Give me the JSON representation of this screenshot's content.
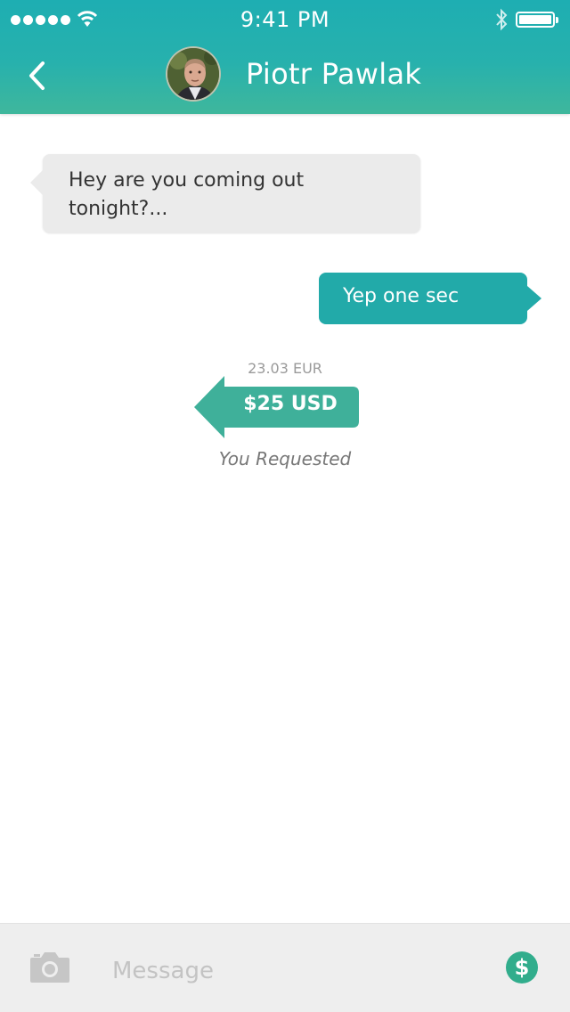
{
  "status_bar": {
    "time": "9:41 PM"
  },
  "header": {
    "contact_name": "Piotr Pawlak"
  },
  "messages": [
    {
      "direction": "incoming",
      "text": "Hey are you coming out tonight?..."
    },
    {
      "direction": "outgoing",
      "text": "Yep one sec"
    }
  ],
  "payment": {
    "converted_amount": "23.03 EUR",
    "amount": "$25 USD",
    "status": "You Requested"
  },
  "composer": {
    "placeholder": "Message",
    "send_money_symbol": "$"
  },
  "colors": {
    "accent": "#22aaa9",
    "header_top": "#1eaeb2",
    "header_bottom": "#3fb79c",
    "payment_green": "#3fb09a"
  }
}
